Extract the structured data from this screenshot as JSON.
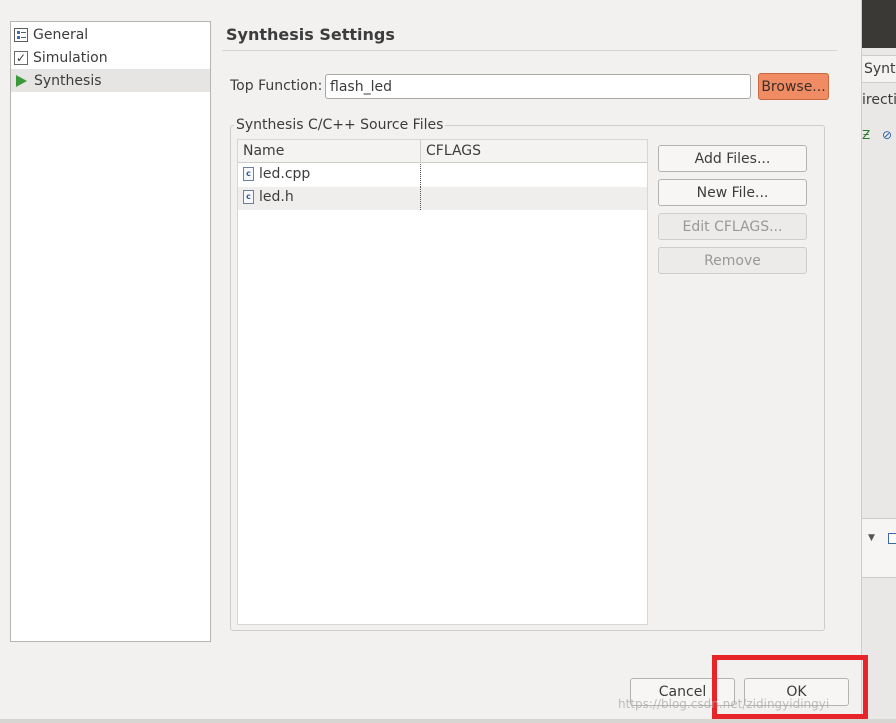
{
  "background_window": {
    "tab_label": "Synth",
    "second_label": "irecti"
  },
  "nav": {
    "items": [
      {
        "label": "General",
        "icon": "general-settings-icon"
      },
      {
        "label": "Simulation",
        "icon": "checkbox-icon"
      },
      {
        "label": "Synthesis",
        "icon": "play-triangle-icon",
        "selected": true
      }
    ]
  },
  "settings": {
    "title": "Synthesis Settings",
    "top_function_label": "Top Function:",
    "top_function_value": "flash_led",
    "browse_label": "Browse..."
  },
  "source_files": {
    "group_label": "Synthesis C/C++ Source Files",
    "columns": [
      "Name",
      "CFLAGS"
    ],
    "rows": [
      {
        "name": "led.cpp",
        "cflags": ""
      },
      {
        "name": "led.h",
        "cflags": ""
      }
    ],
    "buttons": {
      "add_files": "Add Files...",
      "new_file": "New File...",
      "edit_cflags": "Edit CFLAGS...",
      "remove": "Remove"
    }
  },
  "dialog_buttons": {
    "cancel": "Cancel",
    "ok": "OK"
  },
  "watermark": "https://blog.csdn.net/zidingyidingyi",
  "colors": {
    "browse_accent": "#ef8c63",
    "highlight_red": "#e8242b",
    "selected_row": "#e6e5e3"
  }
}
